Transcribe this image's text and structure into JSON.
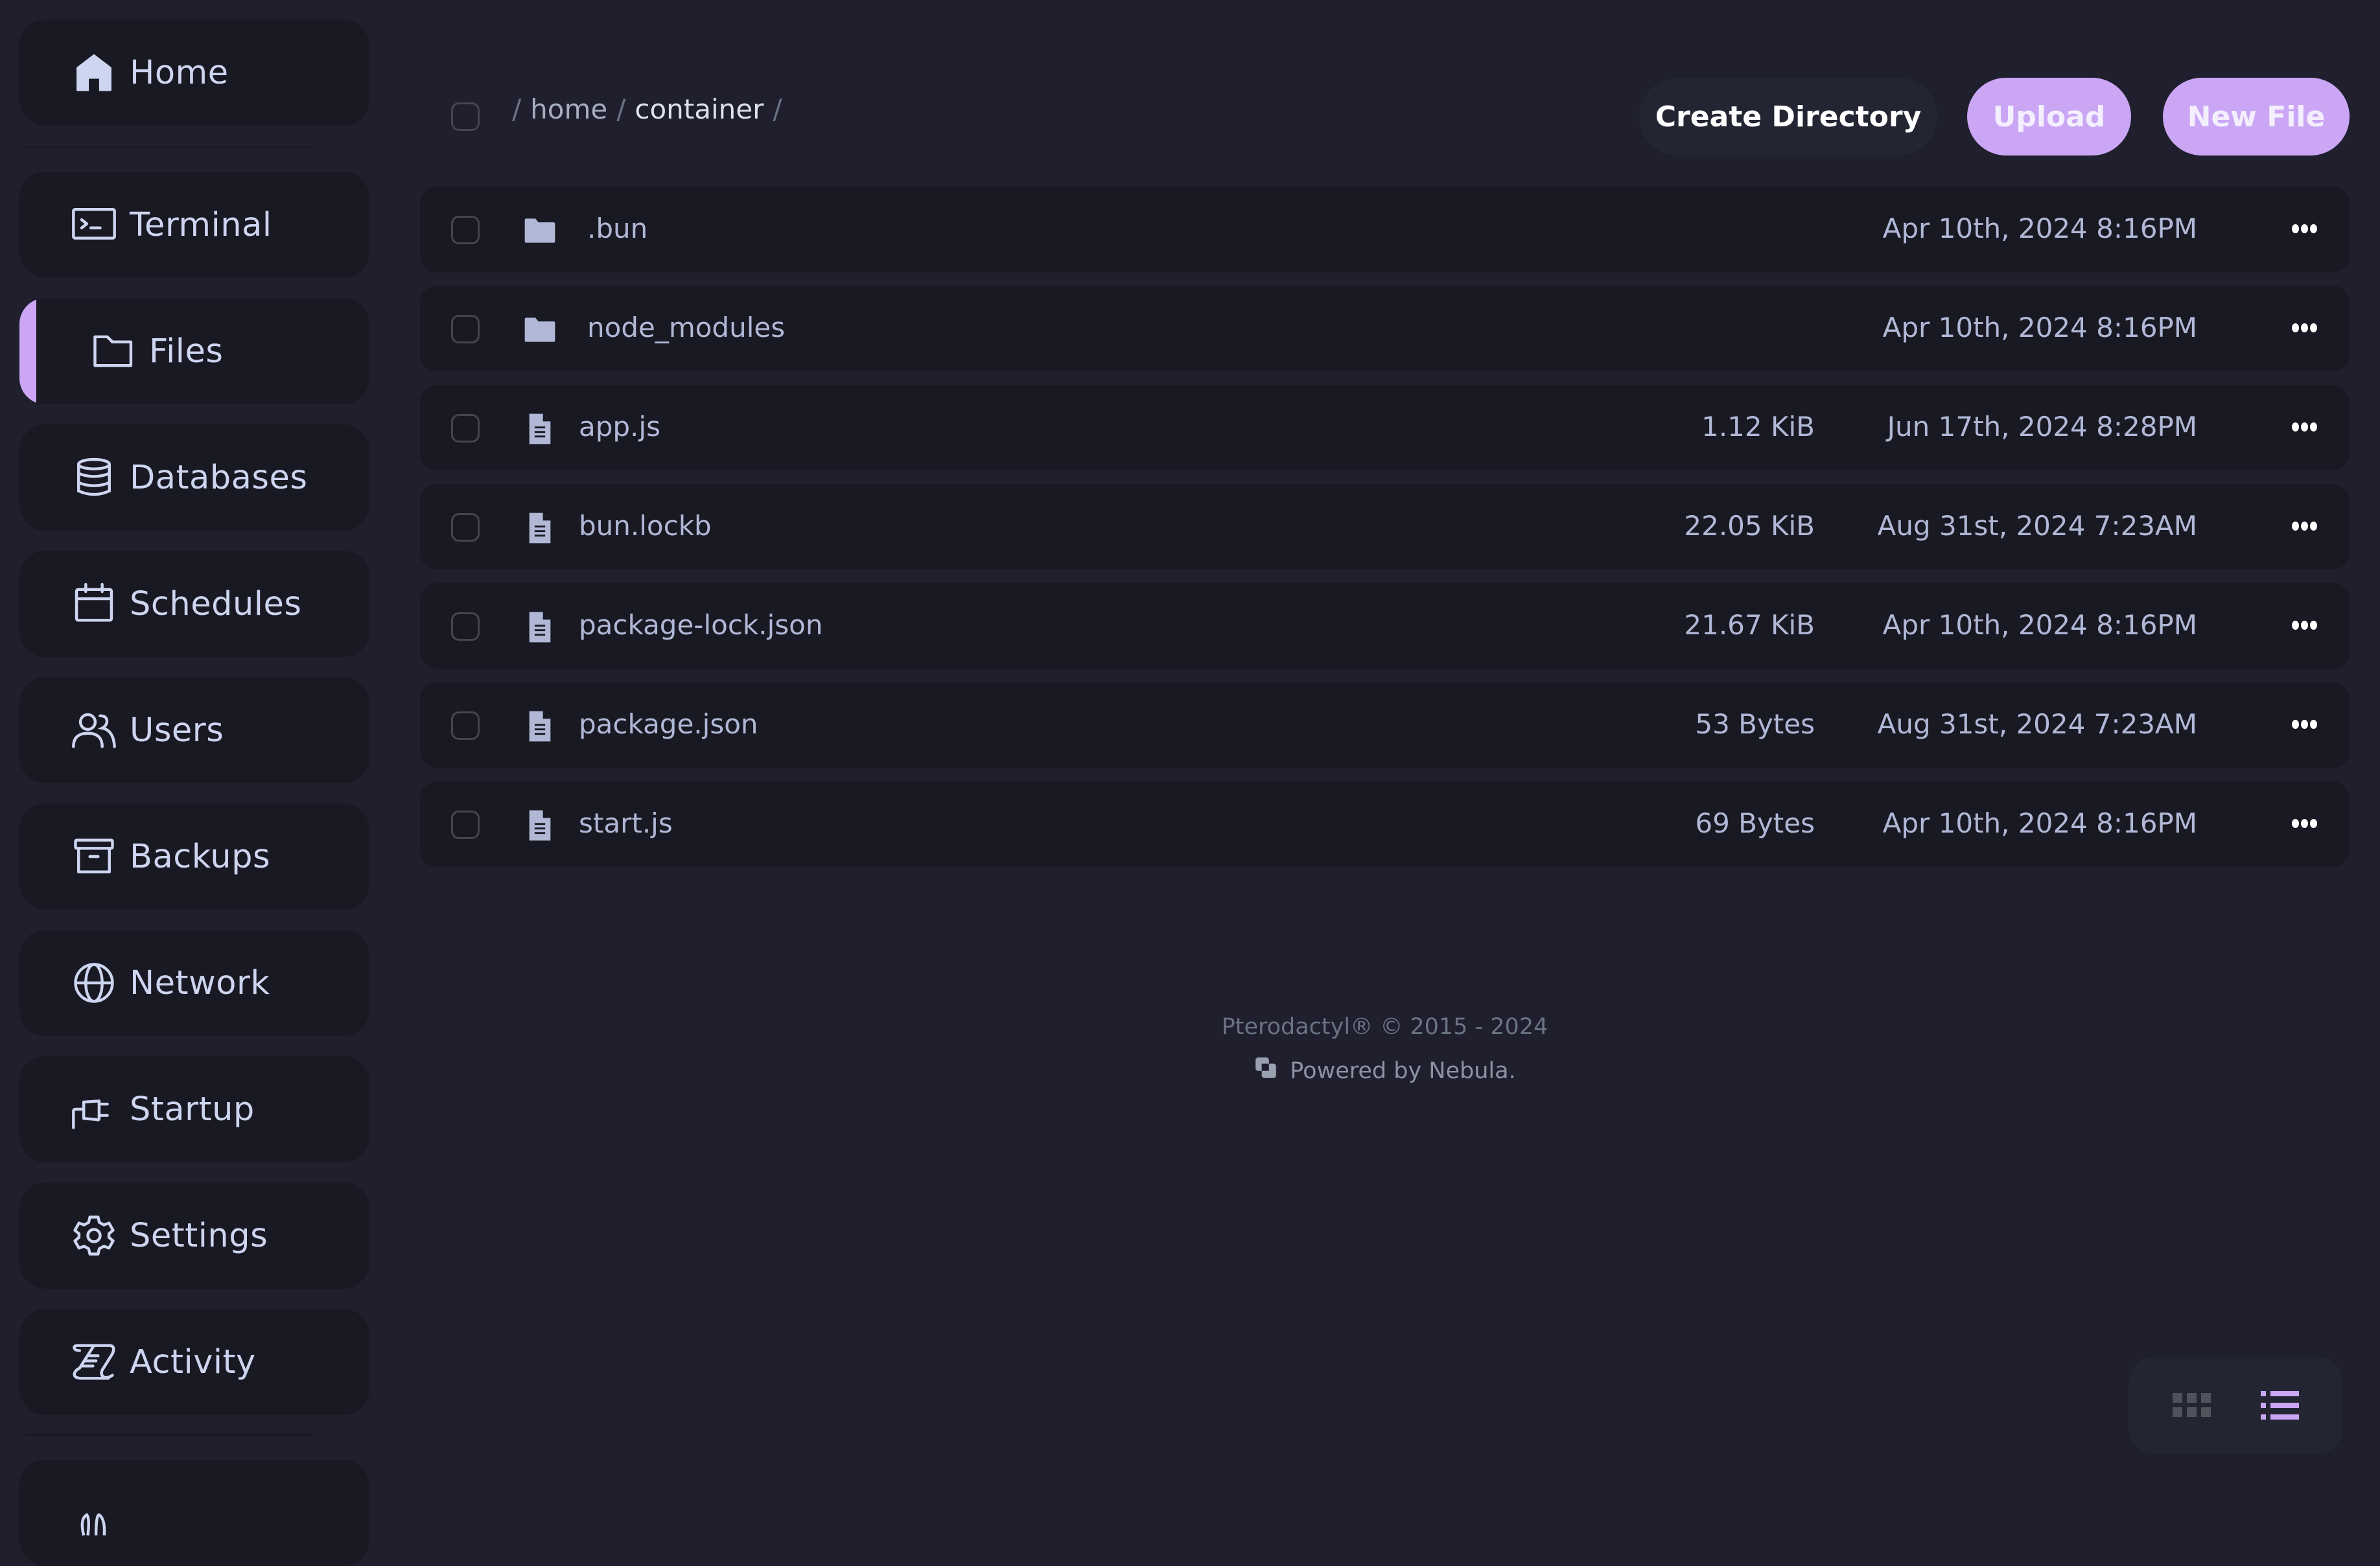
{
  "sidebar": {
    "items": [
      {
        "label": "Home",
        "icon": "home-icon",
        "active": false
      },
      {
        "label": "Terminal",
        "icon": "terminal-icon",
        "active": false
      },
      {
        "label": "Files",
        "icon": "folder-icon",
        "active": true
      },
      {
        "label": "Databases",
        "icon": "database-icon",
        "active": false
      },
      {
        "label": "Schedules",
        "icon": "calendar-icon",
        "active": false
      },
      {
        "label": "Users",
        "icon": "users-icon",
        "active": false
      },
      {
        "label": "Backups",
        "icon": "archive-box-icon",
        "active": false
      },
      {
        "label": "Network",
        "icon": "globe-icon",
        "active": false
      },
      {
        "label": "Startup",
        "icon": "plug-icon",
        "active": false
      },
      {
        "label": "Settings",
        "icon": "gear-icon",
        "active": false
      },
      {
        "label": "Activity",
        "icon": "scroll-icon",
        "active": false
      },
      {
        "label": "",
        "icon": "partial-item-icon",
        "active": false
      }
    ]
  },
  "breadcrumb": {
    "separator": "/",
    "segments": [
      "home",
      "container"
    ]
  },
  "toolbar": {
    "create_directory_label": "Create Directory",
    "upload_label": "Upload",
    "new_file_label": "New File"
  },
  "files": [
    {
      "name": ".bun",
      "type": "directory",
      "size": "",
      "modified": "Apr 10th, 2024 8:16PM"
    },
    {
      "name": "node_modules",
      "type": "directory",
      "size": "",
      "modified": "Apr 10th, 2024 8:16PM"
    },
    {
      "name": "app.js",
      "type": "file",
      "size": "1.12 KiB",
      "modified": "Jun 17th, 2024 8:28PM"
    },
    {
      "name": "bun.lockb",
      "type": "file",
      "size": "22.05 KiB",
      "modified": "Aug 31st, 2024 7:23AM"
    },
    {
      "name": "package-lock.json",
      "type": "file",
      "size": "21.67 KiB",
      "modified": "Apr 10th, 2024 8:16PM"
    },
    {
      "name": "package.json",
      "type": "file",
      "size": "53 Bytes",
      "modified": "Aug 31st, 2024 7:23AM"
    },
    {
      "name": "start.js",
      "type": "file",
      "size": "69 Bytes",
      "modified": "Apr 10th, 2024 8:16PM"
    }
  ],
  "footer": {
    "copyright": "Pterodactyl® © 2015 - 2024",
    "powered_by": "Powered by Nebula."
  },
  "view_toggle": {
    "options": [
      "grid",
      "list"
    ],
    "selected": "list"
  },
  "colors": {
    "accent": "#caa6f4",
    "background": "#1f1f2e",
    "card": "#191923",
    "text": "#cdd5f0",
    "muted_text": "#b0b8d6"
  }
}
